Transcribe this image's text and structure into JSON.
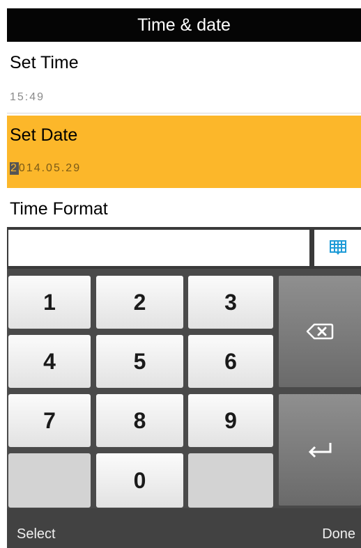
{
  "title": "Time & date",
  "settings": {
    "time": {
      "label": "Set Time",
      "value": "15:49"
    },
    "date": {
      "label": "Set Date",
      "value_first": "2",
      "value_rest": "014.05.29"
    },
    "format": {
      "label": "Time Format"
    }
  },
  "input": {
    "value": ""
  },
  "keypad": {
    "keys": [
      "1",
      "2",
      "3",
      "4",
      "5",
      "6",
      "7",
      "8",
      "9",
      "0"
    ],
    "backspace_icon": "backspace-icon",
    "enter_icon": "enter-icon",
    "keyboard_icon": "keyboard-icon"
  },
  "footer": {
    "left": "Select",
    "right": "Done"
  },
  "colors": {
    "selected_row": "#fcb72a",
    "title_bar": "#050505",
    "keyboard_icon": "#1e9bd7"
  }
}
